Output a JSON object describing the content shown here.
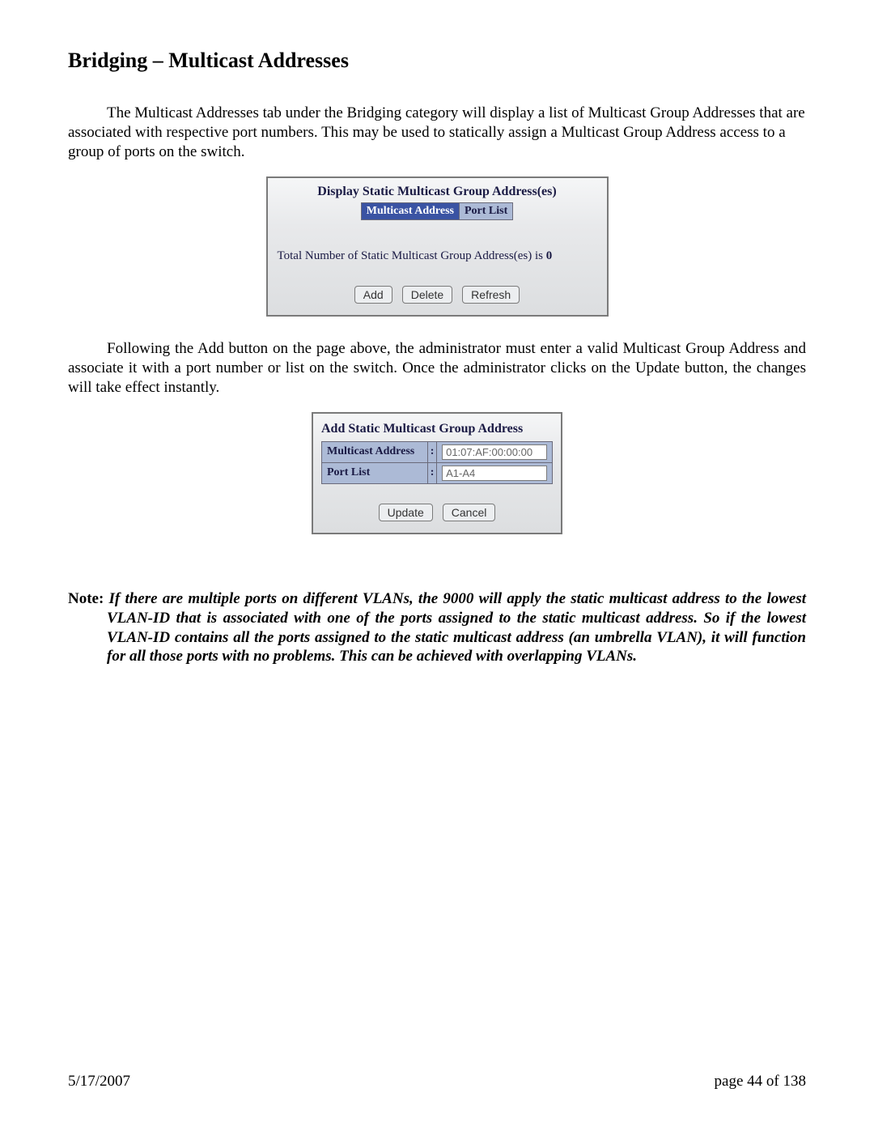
{
  "heading": "Bridging – Multicast Addresses",
  "para1": "The Multicast Addresses tab under the Bridging category will display a list of Multicast Group Addresses that are associated with respective port numbers.  This may be used to statically assign a Multicast Group Address access to a group of ports on the switch.",
  "panel1": {
    "title": "Display Static Multicast Group Address(es)",
    "headers": [
      "Multicast Address",
      "Port List"
    ],
    "total_prefix": "Total Number of Static Multicast Group Address(es) is ",
    "total_value": "0",
    "buttons": {
      "add": "Add",
      "delete": "Delete",
      "refresh": "Refresh"
    }
  },
  "para2": "Following the Add button on the page above, the administrator must enter a valid Multicast Group Address and associate it with a port number or list on the switch.  Once the administrator clicks on the Update button, the changes will take effect instantly.",
  "panel2": {
    "title": "Add Static Multicast Group Address",
    "rows": [
      {
        "label": "Multicast Address",
        "value": "01:07:AF:00:00:00"
      },
      {
        "label": "Port List",
        "value": "A1-A4"
      }
    ],
    "buttons": {
      "update": "Update",
      "cancel": "Cancel"
    }
  },
  "note_label": "Note: ",
  "note_body": "If there are multiple ports on different VLANs, the 9000 will apply the static multicast address to the lowest VLAN-ID that is associated with one of the ports assigned to the static multicast address.  So if the lowest VLAN-ID contains all the ports assigned to the static multicast address (an umbrella VLAN), it will function for all those ports with no problems.  This can be achieved with overlapping VLANs.",
  "footer": {
    "date": "5/17/2007",
    "pageinfo": "page 44 of 138"
  }
}
